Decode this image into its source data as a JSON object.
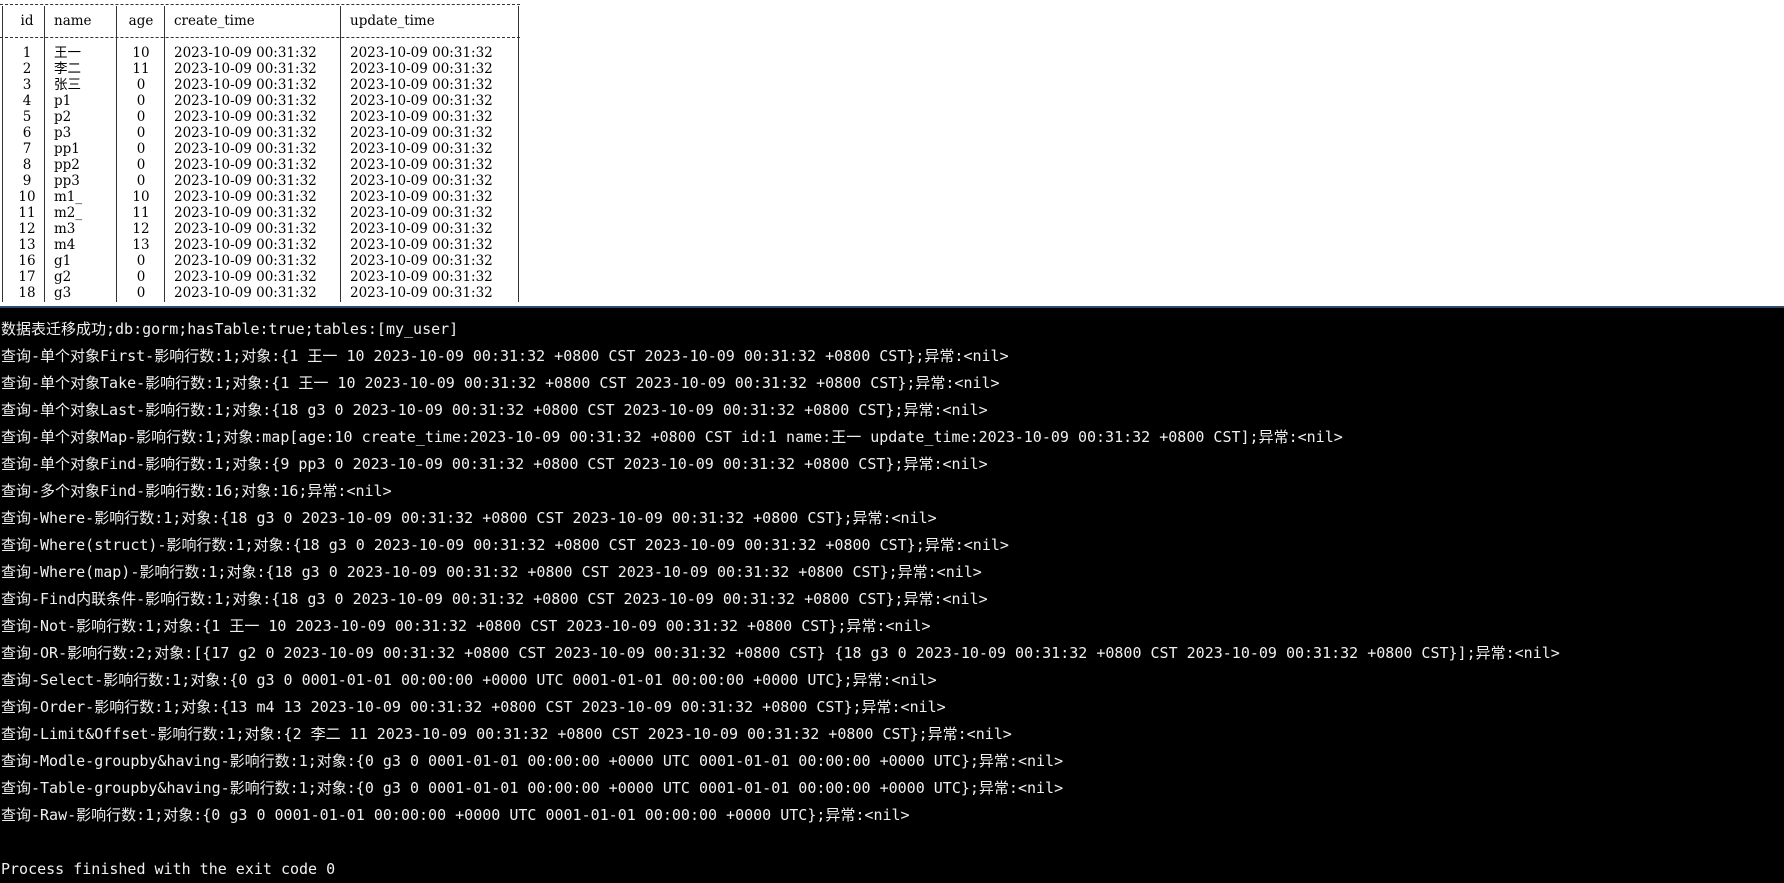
{
  "table": {
    "headers": [
      "id",
      "name",
      "age",
      "create_time",
      "update_time"
    ],
    "rows": [
      [
        "1",
        "王一",
        "10",
        "2023-10-09 00:31:32",
        "2023-10-09 00:31:32"
      ],
      [
        "2",
        "李二",
        "11",
        "2023-10-09 00:31:32",
        "2023-10-09 00:31:32"
      ],
      [
        "3",
        "张三",
        "0",
        "2023-10-09 00:31:32",
        "2023-10-09 00:31:32"
      ],
      [
        "4",
        "p1",
        "0",
        "2023-10-09 00:31:32",
        "2023-10-09 00:31:32"
      ],
      [
        "5",
        "p2",
        "0",
        "2023-10-09 00:31:32",
        "2023-10-09 00:31:32"
      ],
      [
        "6",
        "p3",
        "0",
        "2023-10-09 00:31:32",
        "2023-10-09 00:31:32"
      ],
      [
        "7",
        "pp1",
        "0",
        "2023-10-09 00:31:32",
        "2023-10-09 00:31:32"
      ],
      [
        "8",
        "pp2",
        "0",
        "2023-10-09 00:31:32",
        "2023-10-09 00:31:32"
      ],
      [
        "9",
        "pp3",
        "0",
        "2023-10-09 00:31:32",
        "2023-10-09 00:31:32"
      ],
      [
        "10",
        "m1_",
        "10",
        "2023-10-09 00:31:32",
        "2023-10-09 00:31:32"
      ],
      [
        "11",
        "m2_",
        "11",
        "2023-10-09 00:31:32",
        "2023-10-09 00:31:32"
      ],
      [
        "12",
        "m3",
        "12",
        "2023-10-09 00:31:32",
        "2023-10-09 00:31:32"
      ],
      [
        "13",
        "m4",
        "13",
        "2023-10-09 00:31:32",
        "2023-10-09 00:31:32"
      ],
      [
        "16",
        "g1",
        "0",
        "2023-10-09 00:31:32",
        "2023-10-09 00:31:32"
      ],
      [
        "17",
        "g2",
        "0",
        "2023-10-09 00:31:32",
        "2023-10-09 00:31:32"
      ],
      [
        "18",
        "g3",
        "0",
        "2023-10-09 00:31:32",
        "2023-10-09 00:31:32"
      ]
    ]
  },
  "console": {
    "lines": [
      "数据表迁移成功;db:gorm;hasTable:true;tables:[my_user]",
      "查询-单个对象First-影响行数:1;对象:{1 王一 10 2023-10-09 00:31:32 +0800 CST 2023-10-09 00:31:32 +0800 CST};异常:<nil>",
      "查询-单个对象Take-影响行数:1;对象:{1 王一 10 2023-10-09 00:31:32 +0800 CST 2023-10-09 00:31:32 +0800 CST};异常:<nil>",
      "查询-单个对象Last-影响行数:1;对象:{18 g3 0 2023-10-09 00:31:32 +0800 CST 2023-10-09 00:31:32 +0800 CST};异常:<nil>",
      "查询-单个对象Map-影响行数:1;对象:map[age:10 create_time:2023-10-09 00:31:32 +0800 CST id:1 name:王一 update_time:2023-10-09 00:31:32 +0800 CST];异常:<nil>",
      "查询-单个对象Find-影响行数:1;对象:{9 pp3 0 2023-10-09 00:31:32 +0800 CST 2023-10-09 00:31:32 +0800 CST};异常:<nil>",
      "查询-多个对象Find-影响行数:16;对象:16;异常:<nil>",
      "查询-Where-影响行数:1;对象:{18 g3 0 2023-10-09 00:31:32 +0800 CST 2023-10-09 00:31:32 +0800 CST};异常:<nil>",
      "查询-Where(struct)-影响行数:1;对象:{18 g3 0 2023-10-09 00:31:32 +0800 CST 2023-10-09 00:31:32 +0800 CST};异常:<nil>",
      "查询-Where(map)-影响行数:1;对象:{18 g3 0 2023-10-09 00:31:32 +0800 CST 2023-10-09 00:31:32 +0800 CST};异常:<nil>",
      "查询-Find内联条件-影响行数:1;对象:{18 g3 0 2023-10-09 00:31:32 +0800 CST 2023-10-09 00:31:32 +0800 CST};异常:<nil>",
      "查询-Not-影响行数:1;对象:{1 王一 10 2023-10-09 00:31:32 +0800 CST 2023-10-09 00:31:32 +0800 CST};异常:<nil>",
      "查询-OR-影响行数:2;对象:[{17 g2 0 2023-10-09 00:31:32 +0800 CST 2023-10-09 00:31:32 +0800 CST} {18 g3 0 2023-10-09 00:31:32 +0800 CST 2023-10-09 00:31:32 +0800 CST}];异常:<nil>",
      "查询-Select-影响行数:1;对象:{0 g3 0 0001-01-01 00:00:00 +0000 UTC 0001-01-01 00:00:00 +0000 UTC};异常:<nil>",
      "查询-Order-影响行数:1;对象:{13 m4 13 2023-10-09 00:31:32 +0800 CST 2023-10-09 00:31:32 +0800 CST};异常:<nil>",
      "查询-Limit&Offset-影响行数:1;对象:{2 李二 11 2023-10-09 00:31:32 +0800 CST 2023-10-09 00:31:32 +0800 CST};异常:<nil>",
      "查询-Modle-groupby&having-影响行数:1;对象:{0 g3 0 0001-01-01 00:00:00 +0000 UTC 0001-01-01 00:00:00 +0000 UTC};异常:<nil>",
      "查询-Table-groupby&having-影响行数:1;对象:{0 g3 0 0001-01-01 00:00:00 +0000 UTC 0001-01-01 00:00:00 +0000 UTC};异常:<nil>",
      "查询-Raw-影响行数:1;对象:{0 g3 0 0001-01-01 00:00:00 +0000 UTC 0001-01-01 00:00:00 +0000 UTC};异常:<nil>"
    ],
    "exit_message": "Process finished with the exit code 0"
  }
}
